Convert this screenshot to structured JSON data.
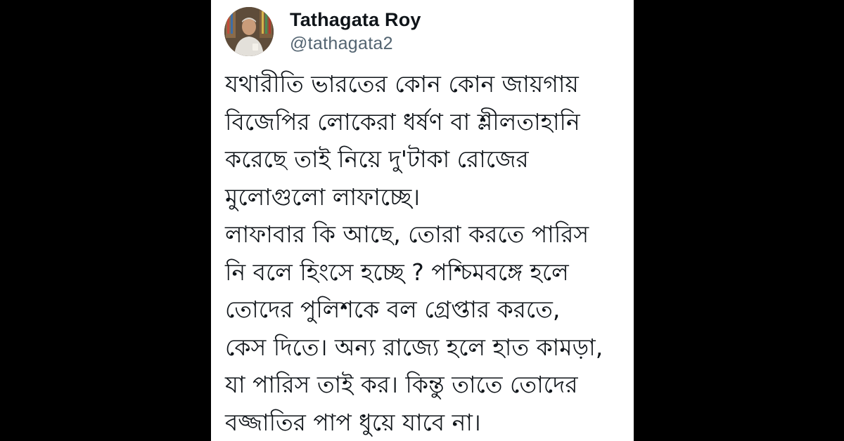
{
  "tweet": {
    "author": {
      "display_name": "Tathagata Roy",
      "handle": "@tathagata2"
    },
    "lines": [
      "যথারীতি ভারতের কোন কোন জায়গায়",
      "বিজেপির লোকেরা ধর্ষণ বা শ্লীলতাহানি",
      "করেছে তাই নিয়ে দু'টাকা রোজের",
      "মুলোগুলো লাফাচ্ছে।",
      "লাফাবার কি আছে, তোরা করতে পারিস",
      "নি বলে হিংসে হচ্ছে ? পশ্চিমবঙ্গে হলে",
      "তোদের পুলিশকে বল গ্রেপ্তার করতে,",
      "কেস দিতে।  অন্য রাজ্যে হলে হাত কামড়া,",
      "যা পারিস তাই কর। কিন্তু তাতে তোদের",
      "বজ্জাতির পাপ ধুয়ে যাবে না।"
    ]
  },
  "colors": {
    "background": "#000000",
    "card": "#ffffff",
    "text_primary": "#0f1419",
    "text_secondary": "#536471"
  }
}
